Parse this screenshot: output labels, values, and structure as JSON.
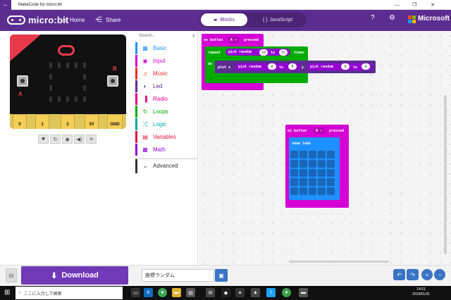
{
  "window": {
    "title": "MakeCode for micro:bit",
    "min": "—",
    "max": "❐",
    "close": "✕"
  },
  "header": {
    "logo": "micro:bit",
    "home_label": "Home",
    "share_label": "Share",
    "blocks_tab": "Blocks",
    "js_tab": "JavaScript",
    "ms_label": "Microsoft",
    "help_icon": "?",
    "settings_icon": "⚙"
  },
  "simulator": {
    "pins": [
      "0",
      "1",
      "2",
      "3V",
      "GND"
    ],
    "label_a": "A",
    "label_b": "B",
    "controls": [
      "■",
      "↻",
      "◉",
      "◀)",
      "✕"
    ]
  },
  "toolbox": {
    "search_placeholder": "Search...",
    "categories": [
      {
        "label": "Basic",
        "color": "#1e90ff",
        "icon": "▦"
      },
      {
        "label": "Input",
        "color": "#d400d4",
        "icon": "◉"
      },
      {
        "label": "Music",
        "color": "#e63022",
        "icon": "♫"
      },
      {
        "label": "Led",
        "color": "#5c2d91",
        "icon": "◐"
      },
      {
        "label": "Radio",
        "color": "#e3008c",
        "icon": "▐"
      },
      {
        "label": "Loops",
        "color": "#00aa00",
        "icon": "↻"
      },
      {
        "label": "Logic",
        "color": "#00a4a6",
        "icon": "⤮"
      },
      {
        "label": "Variables",
        "color": "#dc143c",
        "icon": "▤"
      },
      {
        "label": "Math",
        "color": "#9400d3",
        "icon": "▦"
      }
    ],
    "advanced_label": "Advanced"
  },
  "blocks": {
    "event_a": {
      "text": "on button",
      "button": "A ▾",
      "suffix": "pressed"
    },
    "repeat": {
      "text": "repeat",
      "suffix": "times",
      "do": "do"
    },
    "pick1": {
      "text": "pick random",
      "from": "10",
      "to_label": "to",
      "to": "15"
    },
    "plot": {
      "text": "plot x",
      "y_label": "y"
    },
    "pick2": {
      "text": "pick random",
      "from": "0",
      "to_label": "to",
      "to": "4"
    },
    "pick3": {
      "text": "pick random",
      "from": "0",
      "to_label": "to",
      "to": "4"
    },
    "event_b": {
      "text": "on button",
      "button": "B ▾",
      "suffix": "pressed"
    },
    "show_leds": {
      "text": "show leds"
    }
  },
  "bottom": {
    "download_label": "Download",
    "project_name": "座標ランダム",
    "undo": "↶",
    "redo": "↷",
    "zoom_in": "+",
    "zoom_out": "−"
  },
  "taskbar": {
    "search_placeholder": "ここに入力して検索",
    "time": "14:51",
    "date": "2019/01/31"
  },
  "colors": {
    "brand": "#5c2d91",
    "event_block": "#d400d4",
    "loop_block": "#00aa00",
    "led_block": "#5c2d91",
    "basic_block": "#1e90ff"
  }
}
